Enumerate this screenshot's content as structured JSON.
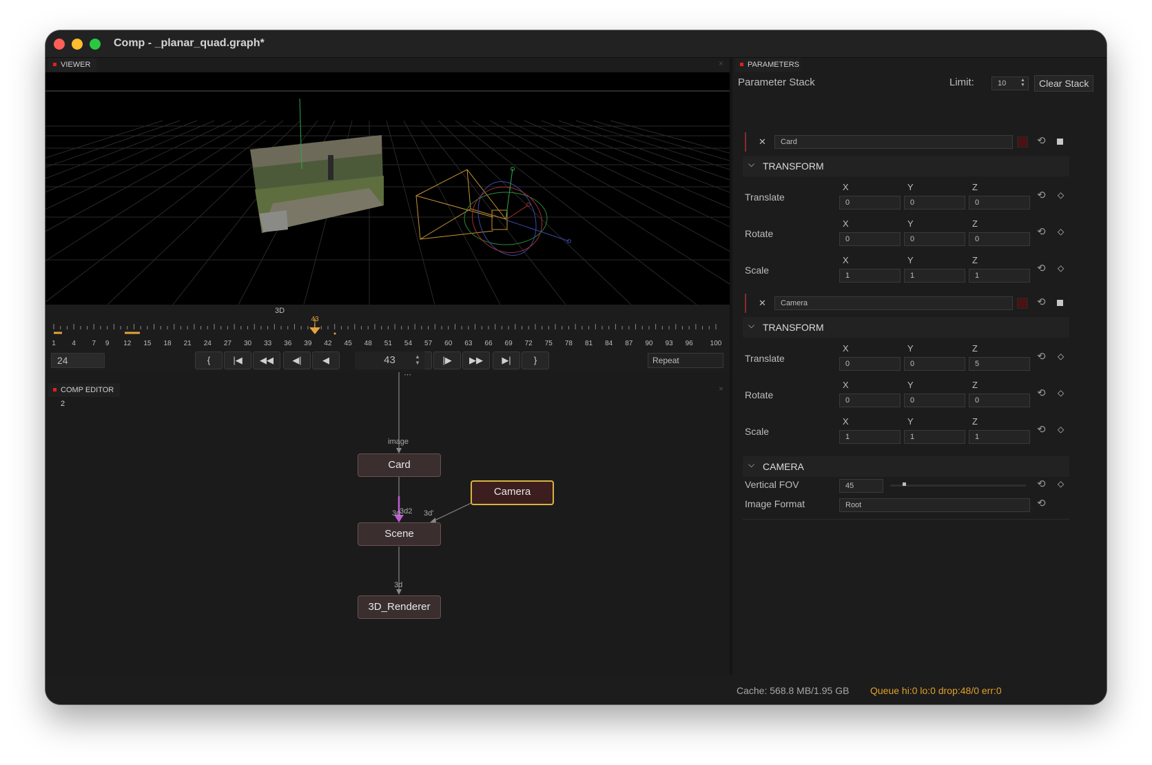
{
  "window": {
    "title": "Comp - _planar_quad.graph*"
  },
  "viewer": {
    "tab": "VIEWER",
    "close": "×",
    "mode_label": "3D",
    "playhead_label": "43",
    "tick_labels": [
      "1",
      "4",
      "7",
      "9",
      "12",
      "15",
      "18",
      "21",
      "24",
      "27",
      "30",
      "33",
      "36",
      "39",
      "42",
      "45",
      "48",
      "51",
      "54",
      "57",
      "60",
      "63",
      "66",
      "69",
      "72",
      "75",
      "78",
      "81",
      "84",
      "87",
      "90",
      "93",
      "96",
      "100"
    ]
  },
  "playback": {
    "start_frame": "24",
    "current_frame": "43",
    "loop_mode": "Repeat",
    "buttons": [
      {
        "name": "set-in-button",
        "glyph": "{"
      },
      {
        "name": "go-to-start-button",
        "glyph": "|◀"
      },
      {
        "name": "rewind-button",
        "glyph": "◀◀"
      },
      {
        "name": "step-back-button",
        "glyph": "◀|"
      },
      {
        "name": "play-backward-button",
        "glyph": "◀"
      },
      {
        "name": "play-forward-button",
        "glyph": "▶"
      },
      {
        "name": "step-forward-button",
        "glyph": "|▶"
      },
      {
        "name": "fast-forward-button",
        "glyph": "▶▶"
      },
      {
        "name": "go-to-end-button",
        "glyph": "▶|"
      },
      {
        "name": "set-out-button",
        "glyph": "}"
      }
    ]
  },
  "comp_editor": {
    "tab": "COMP EDITOR 2",
    "close": "×",
    "nodes": {
      "card": "Card",
      "camera": "Camera",
      "scene": "Scene",
      "renderer": "3D_Renderer"
    },
    "ports": {
      "image": "image",
      "3d": "3d",
      "3d2": "3d2",
      "3d_cam": "3d'",
      "3d_out": "3d"
    }
  },
  "parameters": {
    "tab": "PARAMETERS",
    "stack_label": "Parameter Stack",
    "limit_label": "Limit:",
    "limit_value": "10",
    "clear_label": "Clear Stack",
    "remove_glyph": "✕",
    "axes": [
      "X",
      "Y",
      "Z"
    ],
    "items": [
      {
        "name": "Card",
        "section": "TRANSFORM",
        "rows": [
          {
            "label": "Translate",
            "values": [
              "0",
              "0",
              "0"
            ]
          },
          {
            "label": "Rotate",
            "values": [
              "0",
              "0",
              "0"
            ]
          },
          {
            "label": "Scale",
            "values": [
              "1",
              "1",
              "1"
            ]
          }
        ]
      },
      {
        "name": "Camera",
        "section": "TRANSFORM",
        "rows": [
          {
            "label": "Translate",
            "values": [
              "0",
              "0",
              "5"
            ]
          },
          {
            "label": "Rotate",
            "values": [
              "0",
              "0",
              "0"
            ]
          },
          {
            "label": "Scale",
            "values": [
              "1",
              "1",
              "1"
            ]
          }
        ]
      }
    ],
    "camera_section": {
      "title": "CAMERA",
      "fov_label": "Vertical FOV",
      "fov_value": "45",
      "fov_level": 0.09,
      "format_label": "Image Format",
      "format_value": "Root"
    }
  },
  "status": {
    "cache": "Cache: 568.8 MB/1.95 GB",
    "queue": "Queue hi:0 lo:0 drop:48/0 err:0"
  },
  "colors": {
    "accent_red": "#e02020",
    "selected_node": "#d8b441",
    "queue_text": "#e0a02a",
    "playhead": "#e6a23c"
  }
}
